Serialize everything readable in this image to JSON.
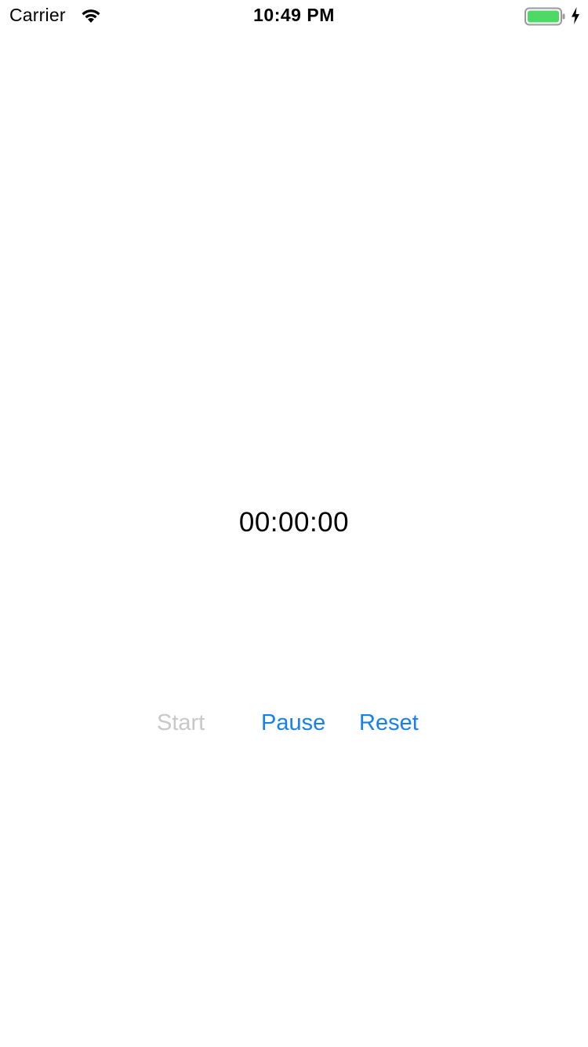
{
  "status_bar": {
    "carrier": "Carrier",
    "time": "10:49 PM",
    "wifi_icon": "wifi-icon",
    "battery_icon": "battery-icon",
    "charging_icon": "charging-bolt-icon",
    "battery_color": "#4cd964"
  },
  "timer": {
    "display": "00:00:00"
  },
  "controls": {
    "start_label": "Start",
    "pause_label": "Pause",
    "reset_label": "Reset",
    "start_enabled": false,
    "pause_enabled": true,
    "reset_enabled": true,
    "accent_color": "#1680ec",
    "disabled_color": "#c8c8c8"
  }
}
